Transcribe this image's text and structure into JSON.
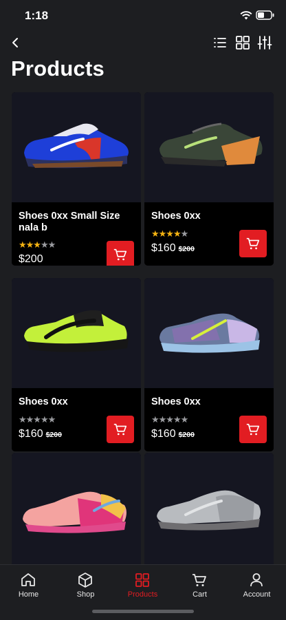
{
  "status": {
    "time": "1:18"
  },
  "header": {
    "title": "Products"
  },
  "products": [
    {
      "name": "Shoes 0xx Small Size nala b",
      "rating": 3,
      "price": "$200",
      "old_price": ""
    },
    {
      "name": "Shoes 0xx",
      "rating": 4,
      "price": "$160",
      "old_price": "$200"
    },
    {
      "name": "Shoes 0xx",
      "rating": 0,
      "price": "$160",
      "old_price": "$200"
    },
    {
      "name": "Shoes 0xx",
      "rating": 0,
      "price": "$160",
      "old_price": "$200"
    },
    {
      "name": "",
      "rating": 0,
      "price": "",
      "old_price": ""
    },
    {
      "name": "",
      "rating": 0,
      "price": "",
      "old_price": ""
    }
  ],
  "tabs": [
    {
      "label": "Home",
      "icon": "home-icon"
    },
    {
      "label": "Shop",
      "icon": "box-icon"
    },
    {
      "label": "Products",
      "icon": "grid-icon",
      "active": true
    },
    {
      "label": "Cart",
      "icon": "cart-icon"
    },
    {
      "label": "Account",
      "icon": "user-icon"
    }
  ],
  "colors": {
    "accent": "#e21d22",
    "star": "#f5b312",
    "background": "#1d1e21"
  }
}
